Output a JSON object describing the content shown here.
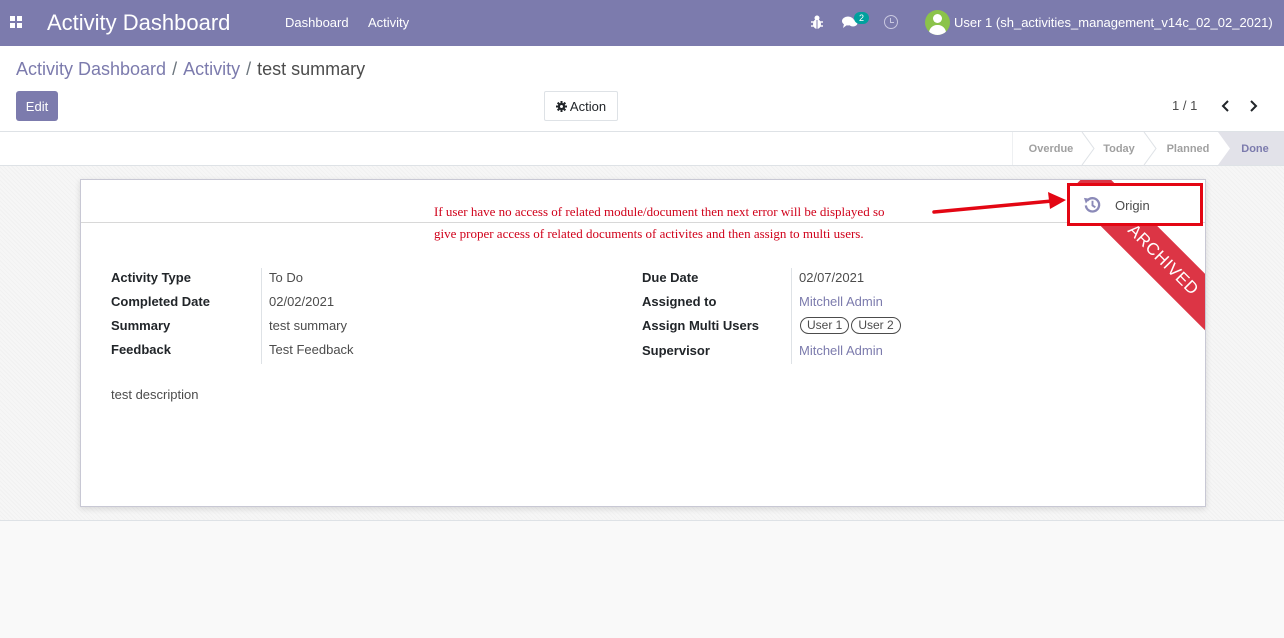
{
  "navbar": {
    "app_title": "Activity Dashboard",
    "menu": [
      "Dashboard",
      "Activity"
    ],
    "messages_badge": "2",
    "user": "User 1 (sh_activities_management_v14c_02_02_2021)",
    "colors": {
      "navbar": "#7c7bad",
      "badge": "#00a09d",
      "avatar": "#8bc34a"
    }
  },
  "breadcrumb": {
    "items": [
      "Activity Dashboard",
      "Activity"
    ],
    "current": "test summary"
  },
  "toolbar": {
    "edit_label": "Edit",
    "action_label": "Action",
    "pager": "1 / 1"
  },
  "status_stages": [
    "Overdue",
    "Today",
    "Planned",
    "Done"
  ],
  "active_stage": "Done",
  "origin_button": {
    "label": "Origin",
    "highlight_color": "#e30613"
  },
  "ribbon": {
    "label": "ARCHIVED",
    "color": "#dc3545"
  },
  "annotation": {
    "line1": "If user have no access of related module/document then next error will be displayed so",
    "line2": "give proper access of related documents of activites and then assign to multi users."
  },
  "fields_left": [
    {
      "label": "Activity Type",
      "value": "To Do"
    },
    {
      "label": "Completed Date",
      "value": "02/02/2021"
    },
    {
      "label": "Summary",
      "value": "test summary"
    },
    {
      "label": "Feedback",
      "value": "Test Feedback"
    }
  ],
  "fields_right": {
    "due_date": {
      "label": "Due Date",
      "value": "02/07/2021"
    },
    "assigned_to": {
      "label": "Assigned to",
      "value": "Mitchell Admin"
    },
    "multi_users": {
      "label": "Assign Multi Users",
      "tags": [
        "User 1",
        "User 2"
      ]
    },
    "supervisor": {
      "label": "Supervisor",
      "value": "Mitchell Admin"
    }
  },
  "description": "test description"
}
